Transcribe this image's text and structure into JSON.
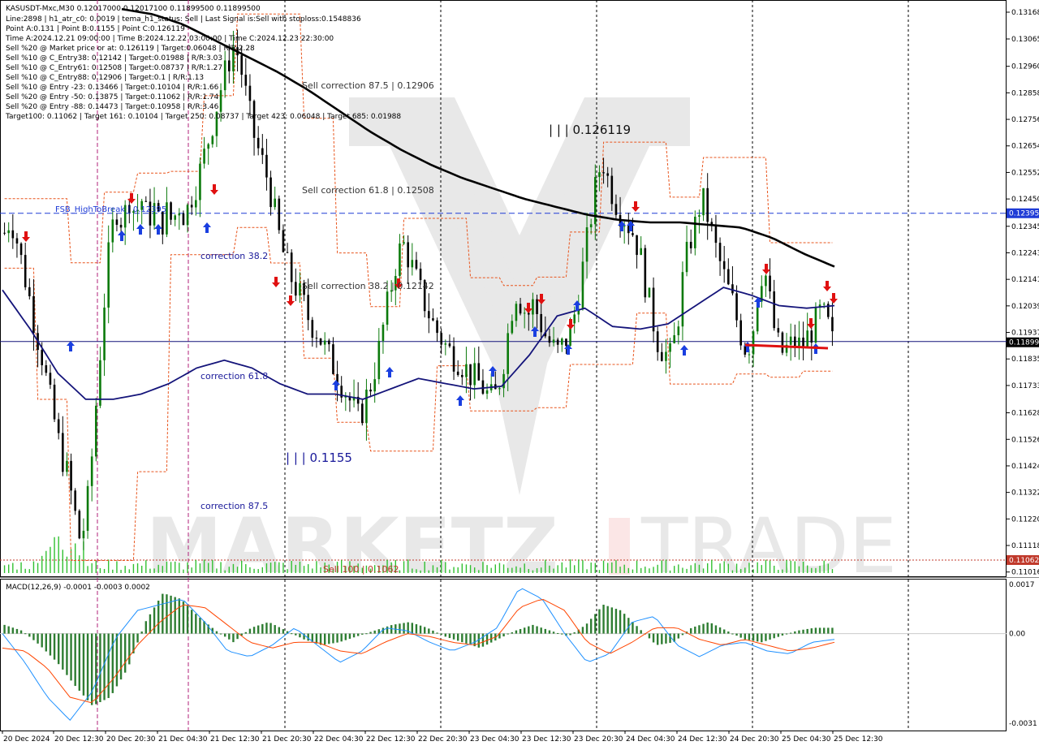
{
  "header": {
    "lines": [
      "KASUSDT-Mxc,M30  0.12017000 0.12017100 0.11899500 0.11899500",
      "Line:2898  |  h1_atr_c0: 0.0019  |  tema_h1_status: Sell  |  Last Signal is:Sell with stoploss:0.1548836",
      "Point A:0.131  |  Point B:0.1155  |  Point C:0.126119",
      "Time A:2024.12.21 09:00:00  |  Time B:2024.12.22 03:00:00  |  Time C:2024.12.23 22:30:00",
      "Sell %20 @ Market price or at: 0.126119  |  Target:0.06048  |  R/R:2.28",
      "Sell %10 @ C_Entry38: 0.12142  |  Target:0.01988  |  R/R:3.03",
      "Sell %10 @ C_Entry61: 0.12508  |  Target:0.08737  |  R/R:1.27",
      "Sell %10 @ C_Entry88: 0.12906  |  Target:0.1  |  R/R:1.13",
      "Sell %10 @ Entry -23: 0.13466  |  Target:0.10104  |  R/R:1.66",
      "Sell %20 @ Entry -50: 0.13875  |  Target:0.11062  |  R/R:1.74",
      "Sell %20 @ Entry -88: 0.14473  |  Target:0.10958  |  R/R:3.46",
      "Target100: 0.11062  |  Target 161: 0.10104  |  Target 250: 0.08737  |  Target 423: 0.06048  |  Target 685: 0.01988"
    ]
  },
  "watermark": {
    "left": "MARKETZ",
    "right": "TRADE"
  },
  "chart_data": [
    {
      "type": "line",
      "symbol": "KASUSDT-Mxc,M30",
      "ylim": [
        0.11012,
        0.13168
      ],
      "y_ticks": [
        "0.13168",
        "0.13065",
        "0.12960",
        "0.12858",
        "0.12756",
        "0.12654",
        "0.12552",
        "0.12450",
        "0.12345",
        "0.12243",
        "0.12141",
        "0.12039",
        "0.11937",
        "0.11835",
        "0.11733",
        "0.11628",
        "0.11526",
        "0.11424",
        "0.11322",
        "0.11220",
        "0.11118",
        "0.11016"
      ],
      "x_labels": [
        "20 Dec 2024",
        "20 Dec 12:30",
        "20 Dec 20:30",
        "21 Dec 04:30",
        "21 Dec 12:30",
        "21 Dec 20:30",
        "22 Dec 04:30",
        "22 Dec 12:30",
        "22 Dec 20:30",
        "23 Dec 04:30",
        "23 Dec 12:30",
        "23 Dec 20:30",
        "24 Dec 04:30",
        "24 Dec 12:30",
        "24 Dec 20:30",
        "25 Dec 04:30",
        "25 Dec 12:30"
      ],
      "price_tags": [
        {
          "value": "0.12395",
          "color": "#1e3bd6"
        },
        {
          "value": "0.11899",
          "color": "#000000"
        },
        {
          "value": "0.11062",
          "color": "#c0392b"
        }
      ],
      "levels": [
        {
          "label": "Sell correction 87.5 | 0.12906",
          "value": 0.12906
        },
        {
          "label": "Sell correction 61.8 | 0.12508",
          "value": 0.12508
        },
        {
          "label": "Sell correction 38.2 | 0.12142",
          "value": 0.12142
        },
        {
          "label": "Sell 100 | 0.1062",
          "value": 0.11062
        }
      ],
      "blue_line": {
        "label": "FSB_HighToBreak | 0.12395",
        "value": 0.12395
      },
      "black_hline_value": 0.11899,
      "red_dotted_value": 0.11062,
      "annotations": [
        {
          "text": "| | | 0.126119",
          "x": 0.126119
        },
        {
          "text": "| | | 0.1155",
          "x": 0.1155
        },
        {
          "text": "correction 38.2"
        },
        {
          "text": "correction 61.8"
        },
        {
          "text": "correction 87.5"
        }
      ],
      "close_series": [
        0.1232,
        0.1238,
        0.1229,
        0.1218,
        0.1207,
        0.1195,
        0.1185,
        0.1172,
        0.116,
        0.1148,
        0.114,
        0.1128,
        0.1115,
        0.112,
        0.1145,
        0.1175,
        0.1205,
        0.123,
        0.1241,
        0.1236,
        0.1246,
        0.1239,
        0.1245,
        0.1237,
        0.1242,
        0.1234,
        0.124,
        0.1236,
        0.1243,
        0.1238,
        0.1246,
        0.1252,
        0.1261,
        0.127,
        0.128,
        0.129,
        0.1298,
        0.1305,
        0.1295,
        0.1282,
        0.127,
        0.1262,
        0.1255,
        0.1245,
        0.1232,
        0.1222,
        0.1215,
        0.121,
        0.1205,
        0.1198,
        0.1195,
        0.119,
        0.1185,
        0.118,
        0.1175,
        0.117,
        0.1165,
        0.116,
        0.1168,
        0.1175,
        0.1185,
        0.1198,
        0.121,
        0.1222,
        0.1228,
        0.1222,
        0.1215,
        0.1208,
        0.1202,
        0.1196,
        0.1192,
        0.1188,
        0.1185,
        0.1183,
        0.118,
        0.1177,
        0.1175,
        0.1172,
        0.1168,
        0.117,
        0.118,
        0.1195,
        0.121,
        0.1205,
        0.12,
        0.1205,
        0.1198,
        0.1192,
        0.1188,
        0.1186,
        0.119,
        0.1195,
        0.1205,
        0.122,
        0.1235,
        0.125,
        0.1261,
        0.1252,
        0.1245,
        0.124,
        0.1236,
        0.1232,
        0.1225,
        0.1212,
        0.12,
        0.119,
        0.1186,
        0.1184,
        0.1195,
        0.1215,
        0.1228,
        0.1235,
        0.1246,
        0.1238,
        0.1228,
        0.122,
        0.1212,
        0.1205,
        0.1195,
        0.1188,
        0.119,
        0.121,
        0.122,
        0.1205,
        0.119,
        0.1186,
        0.1188,
        0.119,
        0.1188,
        0.1192,
        0.1196,
        0.1201,
        0.1199,
        0.119
      ],
      "ma_black": [
        0.1318,
        0.1316,
        0.1312,
        0.1306,
        0.13,
        0.1294,
        0.1287,
        0.1279,
        0.1271,
        0.1264,
        0.1258,
        0.1253,
        0.1249,
        0.1245,
        0.1242,
        0.1239,
        0.1237,
        0.1236,
        0.1236,
        0.1235,
        0.1234,
        0.123,
        0.1224,
        0.1219
      ],
      "ma_navy": [
        0.121,
        0.1195,
        0.1178,
        0.1168,
        0.1168,
        0.117,
        0.1174,
        0.118,
        0.1183,
        0.118,
        0.1174,
        0.117,
        0.117,
        0.1168,
        0.1172,
        0.1176,
        0.1174,
        0.1172,
        0.1173,
        0.1185,
        0.12,
        0.1203,
        0.1196,
        0.1195,
        0.1197,
        0.1204,
        0.1211,
        0.1208,
        0.1204,
        0.1203,
        0.1204
      ]
    },
    {
      "type": "bar",
      "title": "MACD(12,26,9) -0.0001 -0.0003 0.0002",
      "ylim": [
        -0.0031,
        0.0017
      ],
      "y_ticks": [
        "0.0017",
        "0.00",
        "-0.0031"
      ],
      "histogram": [
        0.0003,
        0.0001,
        -0.0004,
        -0.001,
        -0.0018,
        -0.0025,
        -0.0022,
        -0.0012,
        0.0004,
        0.0014,
        0.0012,
        0.0006,
        0.0001,
        -0.0003,
        0.0002,
        0.0004,
        0.0001,
        -0.0002,
        -0.0004,
        -0.0003,
        -0.0001,
        0.0001,
        0.0003,
        0.0004,
        0.0002,
        -0.0001,
        -0.0003,
        -0.0005,
        -0.0002,
        0.0001,
        0.0003,
        0.0001,
        -0.0001,
        0.0003,
        0.001,
        0.0008,
        0.0002,
        -0.0004,
        -0.0003,
        0.0002,
        0.0004,
        0.0001,
        -0.0002,
        -0.0003,
        -0.0001,
        0.0001,
        0.0002,
        0.0002
      ],
      "series": [
        {
          "name": "MACD",
          "values": [
            0.0,
            -0.001,
            -0.0022,
            -0.003,
            -0.002,
            -0.0002,
            0.0008,
            0.001,
            0.0012,
            0.0004,
            -0.0006,
            -0.0008,
            -0.0004,
            0.0002,
            -0.0004,
            -0.001,
            -0.0006,
            0.0002,
            0.0001,
            -0.0003,
            -0.0006,
            -0.0003,
            0.0002,
            0.0016,
            0.0012,
            0.0,
            -0.001,
            -0.0007,
            0.0004,
            0.0006,
            -0.0004,
            -0.0008,
            -0.0004,
            -0.0003,
            -0.0006,
            -0.0007,
            -0.0003,
            -0.0002
          ]
        },
        {
          "name": "Signal",
          "values": [
            -0.0005,
            -0.0006,
            -0.0012,
            -0.0022,
            -0.0024,
            -0.0015,
            -0.0004,
            0.0004,
            0.001,
            0.0009,
            0.0003,
            -0.0003,
            -0.0005,
            -0.0003,
            -0.0003,
            -0.0006,
            -0.0007,
            -0.0003,
            0.0,
            -0.0001,
            -0.0003,
            -0.0004,
            -0.0001,
            0.0009,
            0.0012,
            0.0008,
            -0.0003,
            -0.0007,
            -0.0003,
            0.0002,
            0.0002,
            -0.0002,
            -0.0004,
            -0.0002,
            -0.0004,
            -0.0006,
            -0.0005,
            -0.0003
          ]
        }
      ]
    }
  ],
  "colors": {
    "bull": "#0b7a0b",
    "bear": "#000000",
    "envelope": "#e8541c",
    "ma_black": "#000000",
    "ma_navy": "#14147a",
    "blue_dashed": "#1e3bd6",
    "red_level": "#c0392b",
    "macd": "#1e90ff",
    "signal": "#ff4500",
    "hist": "#2e7d32",
    "vline_magenta": "#b0207a",
    "vline_black": "#000000"
  }
}
